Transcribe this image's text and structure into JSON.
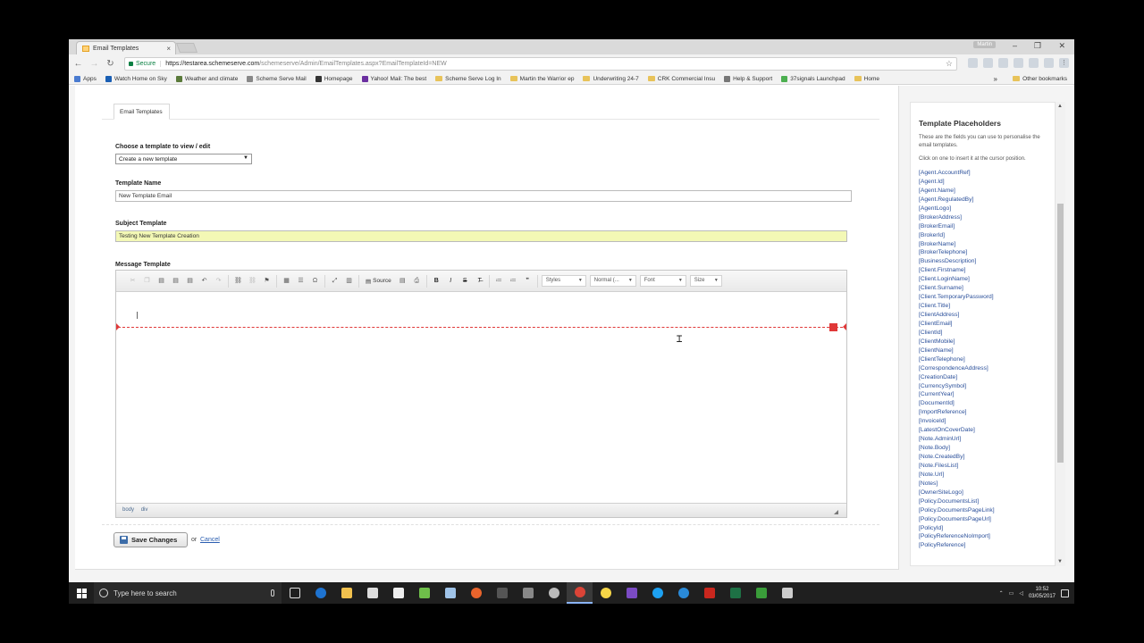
{
  "browser": {
    "tab_title": "Email Templates",
    "tab_close": "×",
    "user_badge": "Martin",
    "secure_label": "Secure",
    "url_host": "https://testarea.schemeserve.com",
    "url_path": "/schemeserve/Admin/EmailTemplates.aspx?EmailTemplateId=NEW",
    "bookmarks": [
      {
        "label": "Apps",
        "kind": "apps"
      },
      {
        "label": "Watch Home on Sky",
        "kind": "site"
      },
      {
        "label": "Weather and climate",
        "kind": "site"
      },
      {
        "label": "Scheme Serve Mail",
        "kind": "site"
      },
      {
        "label": "Homepage",
        "kind": "site"
      },
      {
        "label": "Yahoo! Mail: The best",
        "kind": "site"
      },
      {
        "label": "Scheme Serve Log In",
        "kind": "folder"
      },
      {
        "label": "Martin the Warrior ep",
        "kind": "folder"
      },
      {
        "label": "Underwriting 24-7",
        "kind": "folder"
      },
      {
        "label": "CRK Commercial Insu",
        "kind": "folder"
      },
      {
        "label": "Help & Support",
        "kind": "site"
      },
      {
        "label": "37signals Launchpad",
        "kind": "site"
      },
      {
        "label": "Home",
        "kind": "folder"
      }
    ],
    "bookmarks_more": "»",
    "other_bookmarks": "Other bookmarks"
  },
  "page": {
    "subtab": "Email Templates",
    "choose_label": "Choose a template to view / edit",
    "choose_value": "Create a new template",
    "name_label": "Template Name",
    "name_value": "New Template Email",
    "subject_label": "Subject Template",
    "subject_value": "Testing New Template Creation",
    "message_label": "Message Template",
    "toolbar": {
      "source": "Source",
      "styles": "Styles",
      "format": "Normal (...",
      "font": "Font",
      "size": "Size"
    },
    "path": [
      "body",
      "div"
    ],
    "save_label": "Save Changes",
    "or_text": "or",
    "cancel_label": "Cancel"
  },
  "sidebar": {
    "title": "Template Placeholders",
    "description": "These are the fields you can use to personalise the email templates.",
    "hint": "Click on one to insert it at the cursor position.",
    "placeholders": [
      "[Agent.AccountRef]",
      "[Agent.Id]",
      "[Agent.Name]",
      "[Agent.RegulatedBy]",
      "[AgentLogo]",
      "[BrokerAddress]",
      "[BrokerEmail]",
      "[BrokerId]",
      "[BrokerName]",
      "[BrokerTelephone]",
      "[BusinessDescription]",
      "[Client.Firstname]",
      "[Client.LoginName]",
      "[Client.Surname]",
      "[Client.TemporaryPassword]",
      "[Client.Title]",
      "[ClientAddress]",
      "[ClientEmail]",
      "[ClientId]",
      "[ClientMobile]",
      "[ClientName]",
      "[ClientTelephone]",
      "[CorrespondenceAddress]",
      "[CreationDate]",
      "[CurrencySymbol]",
      "[CurrentYear]",
      "[DocumentId]",
      "[ImportReference]",
      "[InvoiceId]",
      "[LatestOnCoverDate]",
      "[Note.AdminUrl]",
      "[Note.Body]",
      "[Note.CreatedBy]",
      "[Note.FilesList]",
      "[Note.Url]",
      "[Notes]",
      "[OwnerSiteLogo]",
      "[Policy.DocumentsList]",
      "[Policy.DocumentsPageLink]",
      "[Policy.DocumentsPageUrl]",
      "[PolicyId]",
      "[PolicyReferenceNoImport]",
      "[PolicyReference]"
    ]
  },
  "taskbar": {
    "search_placeholder": "Type here to search",
    "time": "10:52",
    "date": "03/05/2017"
  }
}
